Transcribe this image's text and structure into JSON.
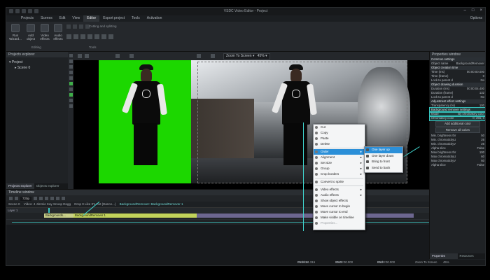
{
  "titlebar": {
    "title": "VSDC Video Editor - Project"
  },
  "menu": {
    "items": [
      "Projects",
      "Scenes",
      "Edit",
      "View",
      "Editor",
      "Export project",
      "Tools",
      "Activation"
    ],
    "active": "Editor",
    "options": "Options"
  },
  "ribbon": {
    "buttons": [
      {
        "label": "Run Wizard..."
      },
      {
        "label": "Add object"
      },
      {
        "label": "Video effects"
      },
      {
        "label": "Audio effects"
      }
    ],
    "groups": {
      "editing": "Editing",
      "tools": "Tools"
    },
    "cutting": "Cutting and splitting"
  },
  "project_explorer": {
    "title": "Projects explorer",
    "root": "Project",
    "scene": "Scene 0",
    "tabs": [
      "Projects explorer",
      "Objects explorer"
    ]
  },
  "canvas_toolbar": {
    "zoom": "Zoom To Screen",
    "zoom_pct": "45%"
  },
  "properties": {
    "title": "Properties window",
    "rows": [
      {
        "k": "Common settings",
        "v": "",
        "type": "sec"
      },
      {
        "k": "Object name",
        "v": "BackgroundRemover"
      },
      {
        "k": "Object creation time",
        "v": "",
        "type": "sec"
      },
      {
        "k": "Time (ms)",
        "v": "00:00:00.000"
      },
      {
        "k": "Time (frame)",
        "v": "0"
      },
      {
        "k": "Lock to parent d",
        "v": "No"
      },
      {
        "k": "Object drawing duration",
        "v": "",
        "type": "sec"
      },
      {
        "k": "Duration (ms)",
        "v": "00:00:04.400"
      },
      {
        "k": "Duration (frame)",
        "v": "132"
      },
      {
        "k": "Lock to parent d",
        "v": "No"
      },
      {
        "k": "Adjustment effect settings",
        "v": "",
        "type": "sec"
      },
      {
        "k": "Transparency (%)",
        "v": "100"
      },
      {
        "k": "Background remover settings",
        "v": "",
        "type": "sec-hl"
      },
      {
        "k": "Mode",
        "v": "By chromakey color",
        "type": "hl"
      },
      {
        "k": "Chromakey color",
        "v": "0; 255; 0",
        "type": "hl"
      },
      {
        "k": "Add additional color",
        "v": "",
        "type": "btn"
      },
      {
        "k": "Remove all colors",
        "v": "",
        "type": "btn"
      },
      {
        "k": "Min. brightness thr",
        "v": "50"
      },
      {
        "k": "Min. chromaticityU",
        "v": "26"
      },
      {
        "k": "Min. chromaticityV",
        "v": "26"
      },
      {
        "k": "Alpha slice",
        "v": "False"
      },
      {
        "k": "Max brightness thr",
        "v": "100"
      },
      {
        "k": "Max chromaticityU",
        "v": "60"
      },
      {
        "k": "Max chromaticityV",
        "v": "60"
      },
      {
        "k": "Alpha slice",
        "v": "False"
      }
    ],
    "tabs": [
      "Properties window",
      "Resources window"
    ]
  },
  "context_menu": {
    "items": [
      {
        "label": "Cut"
      },
      {
        "label": "Copy"
      },
      {
        "label": "Paste"
      },
      {
        "label": "Delete"
      },
      {
        "sep": true
      },
      {
        "label": "Order",
        "arrow": true,
        "hl": true
      },
      {
        "label": "Alignment",
        "arrow": true
      },
      {
        "label": "Set size",
        "arrow": true
      },
      {
        "label": "Group",
        "arrow": true
      },
      {
        "label": "Crop borders",
        "arrow": true
      },
      {
        "sep": true
      },
      {
        "label": "Convert to sprite"
      },
      {
        "sep": true
      },
      {
        "label": "Video effects",
        "arrow": true
      },
      {
        "label": "Audio effects",
        "arrow": true
      },
      {
        "label": "Show object effects"
      },
      {
        "label": "Move cursor to begin"
      },
      {
        "label": "Move cursor to end"
      },
      {
        "label": "Make visible on timeline"
      },
      {
        "label": "Properties...",
        "dis": true
      }
    ],
    "submenu": [
      {
        "label": "One layer up",
        "hl": true
      },
      {
        "label": "One layer down"
      },
      {
        "label": "Bring to front"
      },
      {
        "label": "Send to back"
      }
    ]
  },
  "timeline": {
    "title": "Timeline window",
    "fps": "720p",
    "crumbs": [
      "Scene 0",
      "Video: 4 Jimmie Kay Snoop Dogg",
      "Drop It Like It's Hot (Dance...)",
      "BackgroundRemover: BackgroundRemover 1"
    ],
    "layer_label": "Layer 1",
    "clips": [
      {
        "label": "Backgrounds..."
      },
      {
        "label": "BackgroundRemover 1"
      }
    ]
  },
  "status": {
    "position": "Position:",
    "pos_val": "00:00:01.316",
    "start": "Start selection:",
    "start_val": "00:00:00.000",
    "end": "End selection:",
    "end_val": "00:00:00.000",
    "zoom": "Zoom To Screen",
    "zoom_pct": "45%"
  }
}
